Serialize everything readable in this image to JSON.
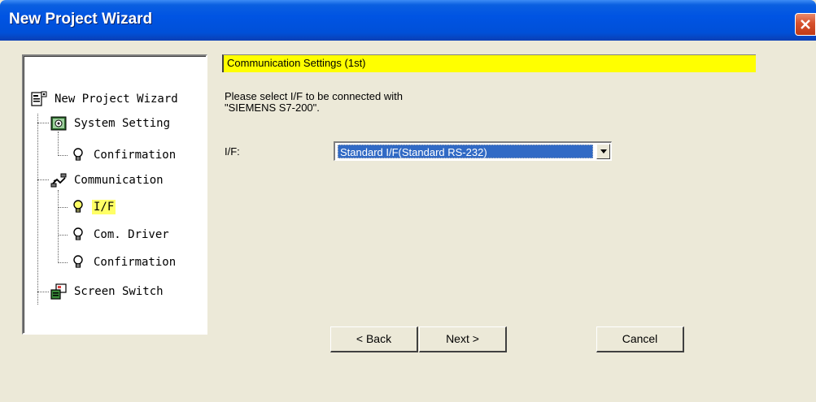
{
  "window": {
    "title": "New Project Wizard"
  },
  "tree": {
    "items": [
      {
        "label": "New Project Wizard",
        "icon": "wizard-icon"
      },
      {
        "label": "System Setting",
        "icon": "system-setting-icon"
      },
      {
        "label": "Confirmation",
        "icon": "bulb-icon"
      },
      {
        "label": "Communication",
        "icon": "communication-icon"
      },
      {
        "label": "I/F",
        "icon": "bulb-lit-icon",
        "selected": true
      },
      {
        "label": "Com. Driver",
        "icon": "bulb-icon"
      },
      {
        "label": "Confirmation",
        "icon": "bulb-icon"
      },
      {
        "label": "Screen Switch",
        "icon": "screen-switch-icon"
      }
    ]
  },
  "content": {
    "section_title": "Communication Settings (1st)",
    "instruction_line1": "Please select I/F to be connected with",
    "instruction_line2": "\"SIEMENS S7-200\".",
    "if_label": "I/F:",
    "if_selected": "Standard I/F(Standard RS-232)"
  },
  "buttons": {
    "back": "< Back",
    "next": "Next >",
    "cancel": "Cancel"
  },
  "colors": {
    "titlebar": "#0054e3",
    "highlight_yellow": "#ffff00",
    "selection_blue": "#316ac5",
    "dialog_bg": "#ece9d8"
  }
}
